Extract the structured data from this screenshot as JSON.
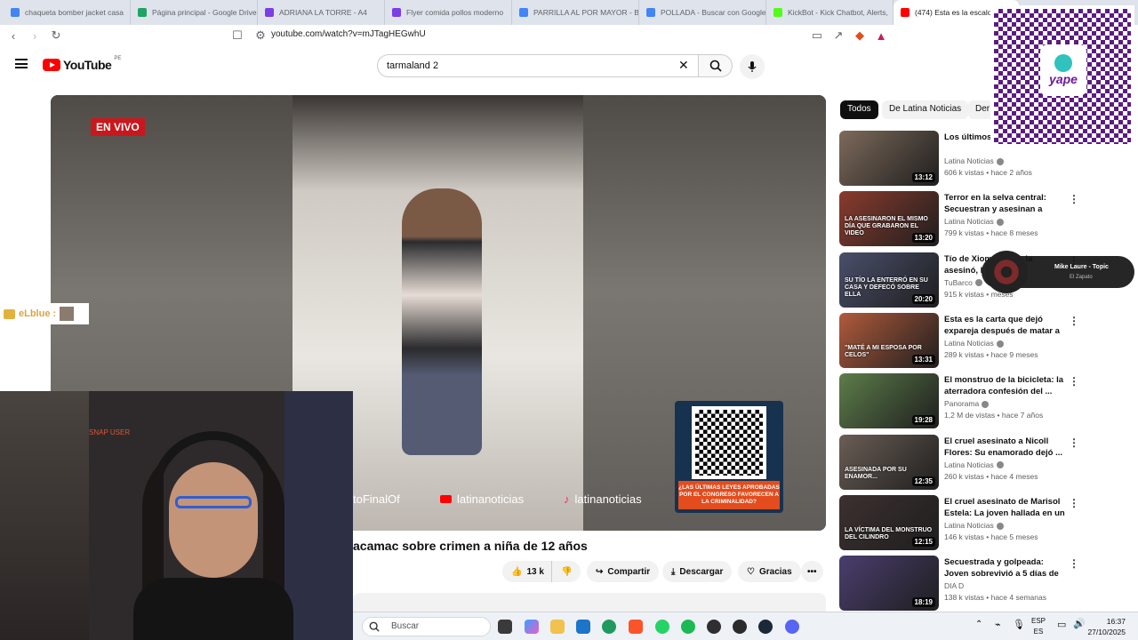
{
  "browser": {
    "tabs": [
      {
        "title": "chaqueta bomber jacket casa",
        "favicon_color": "#4285f4"
      },
      {
        "title": "Página principal - Google Drive",
        "favicon_color": "#1fa463"
      },
      {
        "title": "ADRIANA LA TORRE - A4",
        "favicon_color": "#7b3fe4"
      },
      {
        "title": "Flyer comida pollos moderno",
        "favicon_color": "#7b3fe4"
      },
      {
        "title": "PARRILLA AL POR MAYOR - Bu",
        "favicon_color": "#4285f4"
      },
      {
        "title": "POLLADA - Buscar con Google",
        "favicon_color": "#4285f4"
      },
      {
        "title": "KickBot - Kick Chatbot, Alerts,",
        "favicon_color": "#53fc18"
      },
      {
        "title": "(474) Esta es la escalofri",
        "favicon_color": "#ff0000"
      }
    ],
    "url": "youtube.com/watch?v=mJTagHEGwhU"
  },
  "youtube": {
    "logo_text": "YouTube",
    "country_code": "PE",
    "search_value": "tarmaland 2",
    "live_badge": "EN VIVO",
    "social_handles": [
      "toFinalOf",
      "latinanoticias",
      "latinanoticias"
    ],
    "promo_text": "¿LAS ÚLTIMAS LEYES APROBADAS POR EL CONGRESO FAVORECEN A LA CRIMINALIDAD?",
    "video_title": "acamac sobre crimen a niña de 12 años",
    "actions": {
      "likes": "13 k",
      "share": "Compartir",
      "download": "Descargar",
      "thanks": "Gracias"
    },
    "chips": [
      "Todos",
      "De Latina Noticias",
      "Der"
    ],
    "recommendations": [
      {
        "title": "Los últimos Cris', el sica",
        "channel": "Latina Noticias",
        "verified": true,
        "views": "606 k vistas",
        "age": "hace 2 años",
        "duration": "13:12",
        "color": "#7d6a5a"
      },
      {
        "title": "Terror en la selva central: Secuestran y asesinan a meno...",
        "channel": "Latina Noticias",
        "verified": true,
        "views": "799 k vistas",
        "age": "hace 8 meses",
        "duration": "13:20",
        "color": "#8a3b2d",
        "thumb_text": "LA ASESINARON EL MISMO DÍA QUE GRABARON EL VIDEO"
      },
      {
        "title": "Tío de Xioma... stas la asesinó, l",
        "channel": "TuBarco",
        "verified": true,
        "views": "915 k vistas",
        "age": "meses",
        "duration": "20:20",
        "color": "#4a4f6b",
        "thumb_text": "SU TÍO LA ENTERRÓ EN SU CASA Y DEFECÓ SOBRE ELLA"
      },
      {
        "title": "Esta es la carta que dejó expareja después de matar a l...",
        "channel": "Latina Noticias",
        "verified": true,
        "views": "289 k vistas",
        "age": "hace 9 meses",
        "duration": "13:31",
        "color": "#b05a3c",
        "thumb_text": "\"MATÉ A MI ESPOSA POR CELOS\""
      },
      {
        "title": "El monstruo de la bicicleta: la aterradora confesión del ...",
        "channel": "Panorama",
        "verified": true,
        "views": "1,2 M de vistas",
        "age": "hace 7 años",
        "duration": "19:28",
        "color": "#5d7d4a"
      },
      {
        "title": "El cruel asesinato a Nicoll Flores: Su enamorado dejó ...",
        "channel": "Latina Noticias",
        "verified": true,
        "views": "260 k vistas",
        "age": "hace 4 meses",
        "duration": "12:35",
        "color": "#6b5e55",
        "thumb_text": "ASESINADA POR SU ENAMOR..."
      },
      {
        "title": "El cruel asesinato de Marisol Estela: La joven hallada en un ...",
        "channel": "Latina Noticias",
        "verified": true,
        "views": "146 k vistas",
        "age": "hace 5 meses",
        "duration": "12:15",
        "color": "#3d3030",
        "thumb_text": "LA VÍCTIMA DEL MONSTRUO DEL CILINDRO"
      },
      {
        "title": "Secuestrada y golpeada: Joven sobrevivió a 5 días de secuest...",
        "channel": "DIA D",
        "verified": false,
        "views": "138 k vistas",
        "age": "hace 4 semanas",
        "duration": "18:19",
        "color": "#4a3e6e"
      }
    ]
  },
  "overlays": {
    "chat_user": "eLblue :",
    "webcam_label": "SNAP USER",
    "yape_brand": "yape",
    "music_title": "Mike Laure - Topic",
    "music_subtitle": "El Zapato"
  },
  "taskbar": {
    "search_placeholder": "Buscar",
    "lang_top": "ESP",
    "lang_bottom": "ES",
    "time": "16:37",
    "date": "27/10/2025"
  }
}
